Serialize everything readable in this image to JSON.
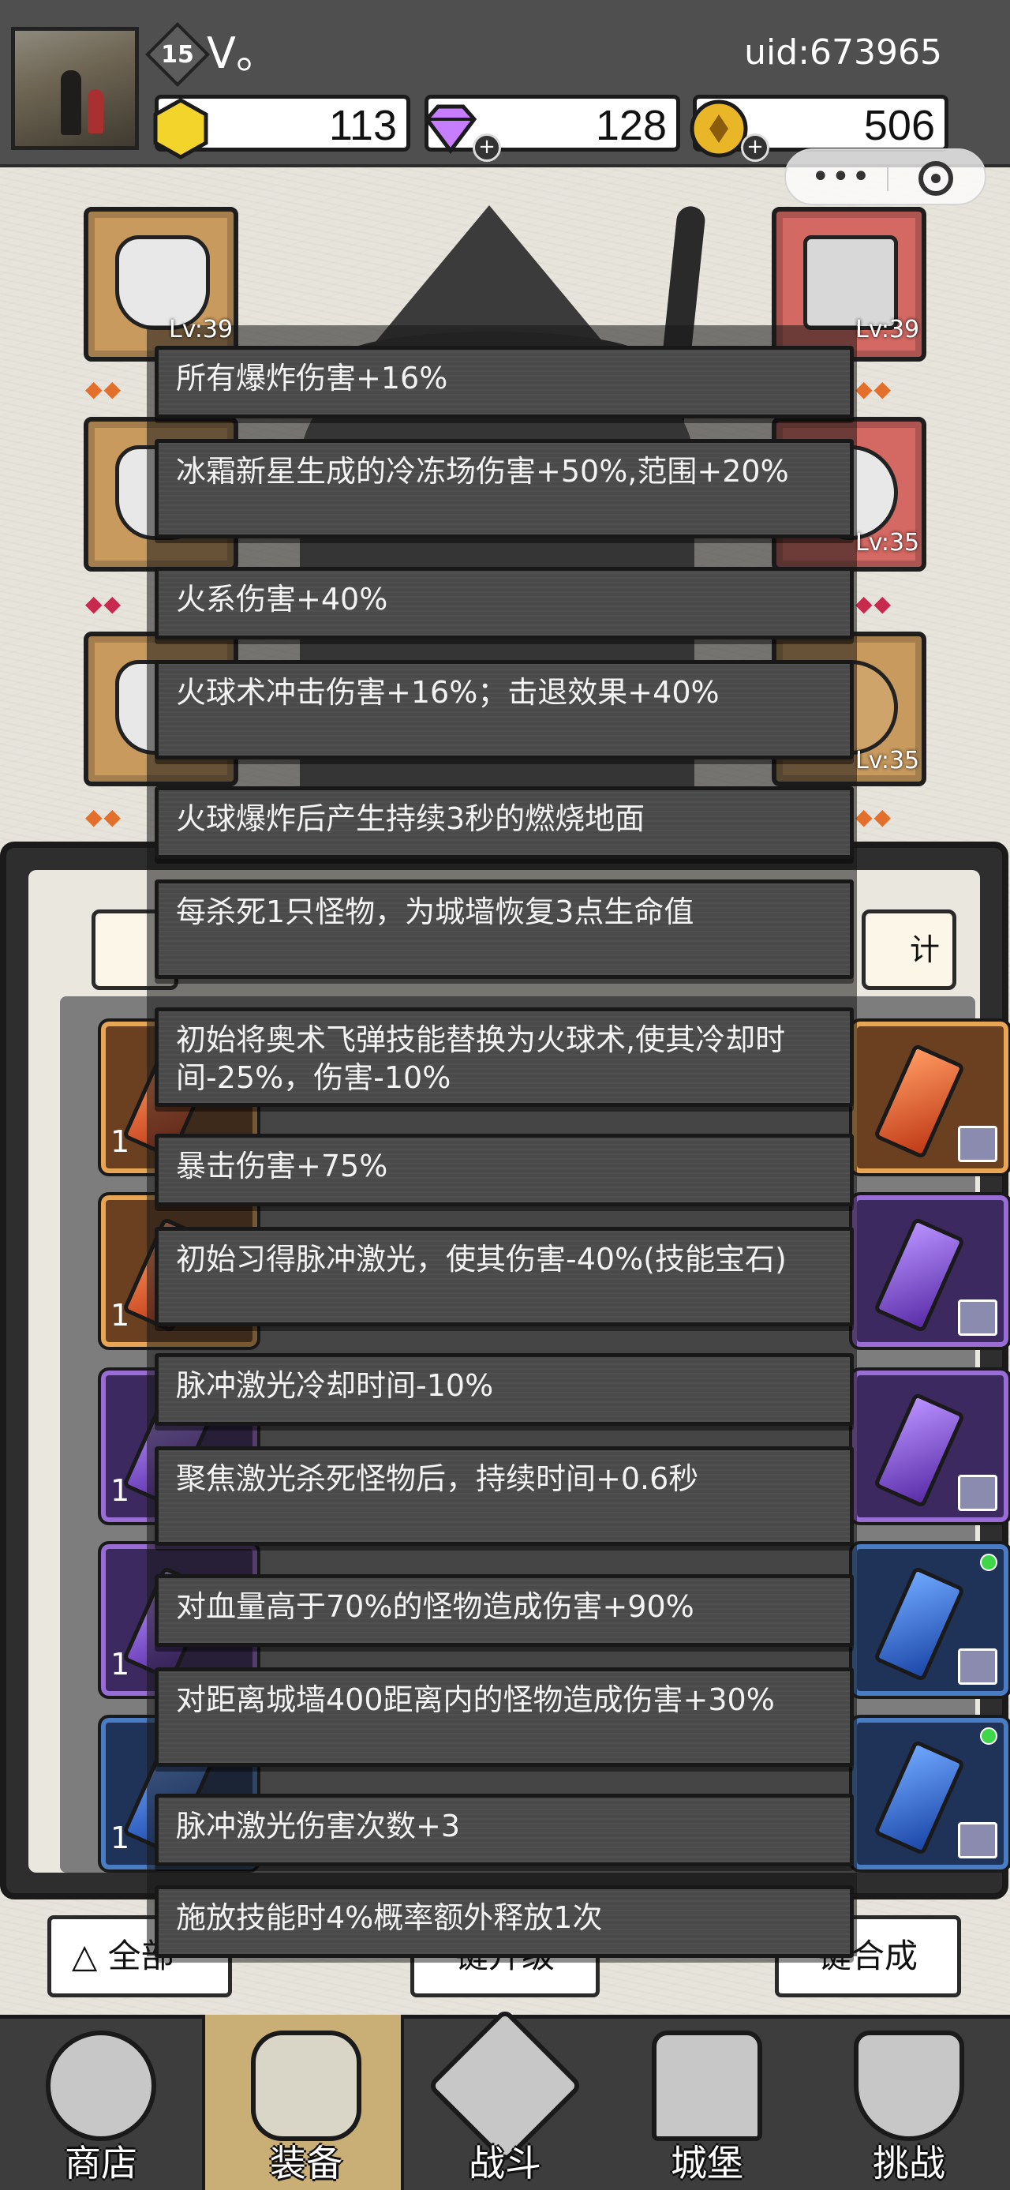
{
  "header": {
    "level": "15",
    "username": "V。",
    "uid": "uid:673965",
    "currencies": [
      {
        "name": "gold-hexagon",
        "value": "113",
        "color": "#f2d42b"
      },
      {
        "name": "diamond",
        "value": "128",
        "color": "#c77dff"
      },
      {
        "name": "coin",
        "value": "506",
        "color": "#e9b628"
      }
    ]
  },
  "equipment": {
    "slots": [
      {
        "side": "left",
        "level": "Lv:39",
        "color": "orange"
      },
      {
        "side": "right",
        "level": "Lv:39",
        "color": "red"
      },
      {
        "side": "left",
        "level": "",
        "color": "orange"
      },
      {
        "side": "right",
        "level": "Lv:35",
        "color": "red"
      },
      {
        "side": "left",
        "level": "",
        "color": "orange"
      },
      {
        "side": "right",
        "level": "Lv:35",
        "color": "orange"
      }
    ]
  },
  "bag": {
    "tab_right": "计",
    "counts": [
      "1",
      "1",
      "1",
      "1",
      "1"
    ],
    "buttons": {
      "filter": "全部",
      "upgrade": "键升级",
      "merge": "键合成"
    }
  },
  "skills": [
    "所有爆炸伤害+16%",
    "冰霜新星生成的冷冻场伤害+50%,范围+20%",
    "火系伤害+40%",
    "火球术冲击伤害+16%；击退效果+40%",
    "火球爆炸后产生持续3秒的燃烧地面",
    "每杀死1只怪物，为城墙恢复3点生命值",
    "初始将奥术飞弹技能替换为火球术,使其冷却时间-25%，伤害-10%",
    "暴击伤害+75%",
    "初始习得脉冲激光，使其伤害-40%(技能宝石)",
    "脉冲激光冷却时间-10%",
    "聚焦激光杀死怪物后，持续时间+0.6秒",
    "对血量高于70%的怪物造成伤害+90%",
    "对距离城墙400距离内的怪物造成伤害+30%",
    "脉冲激光伤害次数+3",
    "施放技能时4%概率额外释放1次"
  ],
  "nav": [
    {
      "label": "商店",
      "icon": "shop-icon"
    },
    {
      "label": "装备",
      "icon": "backpack-icon"
    },
    {
      "label": "战斗",
      "icon": "swords-icon"
    },
    {
      "label": "城堡",
      "icon": "castle-icon"
    },
    {
      "label": "挑战",
      "icon": "shield-icon"
    }
  ]
}
